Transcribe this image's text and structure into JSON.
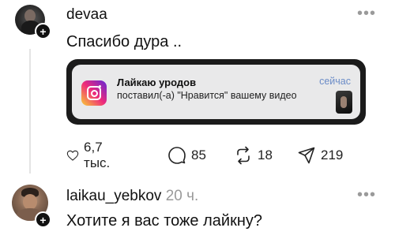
{
  "post": {
    "username": "devaa",
    "text": "Спасибо дура ..",
    "more": "•••"
  },
  "notification": {
    "title": "Лайкаю уродов",
    "body": "поставил(-а) \"Нравится\" вашему видео",
    "time": "сейчас",
    "app_icon": "instagram-icon"
  },
  "actions": {
    "likes": "6,7 тыс.",
    "comments": "85",
    "reposts": "18",
    "shares": "219"
  },
  "reply": {
    "username": "laikau_yebkov",
    "time": "20 ч.",
    "text": "Хотите я вас тоже лайкну?",
    "more": "•••"
  }
}
